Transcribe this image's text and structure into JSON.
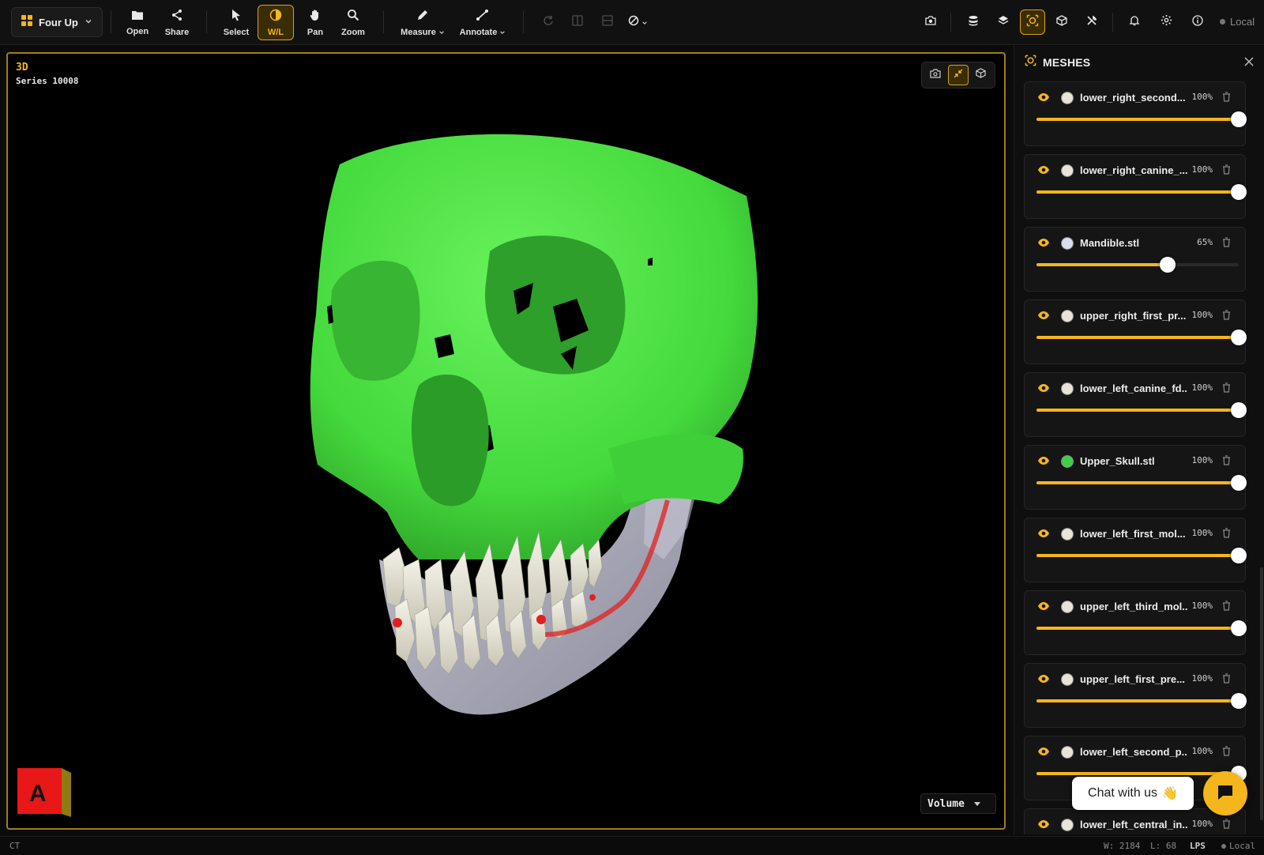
{
  "toolbar": {
    "layout_label": "Four Up",
    "tools": {
      "open": "Open",
      "share": "Share",
      "select": "Select",
      "wl": "W/L",
      "pan": "Pan",
      "zoom": "Zoom",
      "measure": "Measure",
      "annotate": "Annotate"
    },
    "active_tool": "W/L",
    "storage_label": "Local",
    "right_icons": [
      "camera-icon",
      "database-icon",
      "layers-icon",
      "meshes-icon",
      "cube-icon",
      "tools-icon",
      "bell-icon",
      "gear-icon",
      "info-icon"
    ]
  },
  "viewport": {
    "title": "3D",
    "series": "Series 10008",
    "render_mode": "Volume",
    "orientation_label": "A",
    "tools": [
      "camera-icon",
      "collapse-icon",
      "cube-icon"
    ]
  },
  "panel": {
    "title": "MESHES",
    "meshes": [
      {
        "name": "lower_right_second...",
        "opacity": "100%",
        "value": 1.0,
        "color": "#e8e4d8"
      },
      {
        "name": "lower_right_canine_...",
        "opacity": "100%",
        "value": 1.0,
        "color": "#e8e4d8"
      },
      {
        "name": "Mandible.stl",
        "opacity": "65%",
        "value": 0.65,
        "color": "#dcdcf0"
      },
      {
        "name": "upper_right_first_pr...",
        "opacity": "100%",
        "value": 1.0,
        "color": "#e8e4d8"
      },
      {
        "name": "lower_left_canine_fd...",
        "opacity": "100%",
        "value": 1.0,
        "color": "#e8e4d8"
      },
      {
        "name": "Upper_Skull.stl",
        "opacity": "100%",
        "value": 1.0,
        "color": "#3ecf4a"
      },
      {
        "name": "lower_left_first_mol...",
        "opacity": "100%",
        "value": 1.0,
        "color": "#e8e4d8"
      },
      {
        "name": "upper_left_third_mol...",
        "opacity": "100%",
        "value": 1.0,
        "color": "#e8e4d8"
      },
      {
        "name": "upper_left_first_pre...",
        "opacity": "100%",
        "value": 1.0,
        "color": "#e8e4d8"
      },
      {
        "name": "lower_left_second_p...",
        "opacity": "100%",
        "value": 1.0,
        "color": "#e8e4d8"
      },
      {
        "name": "lower_left_central_in...",
        "opacity": "100%",
        "value": 1.0,
        "color": "#e8e4d8"
      }
    ]
  },
  "chat": {
    "label": "Chat with us",
    "emoji": "👋"
  },
  "status": {
    "modality": "CT",
    "window": "W: 2184",
    "level": "L: 68",
    "orientation": "LPS",
    "storage": "Local"
  },
  "colors": {
    "accent": "#f5b51c",
    "skull": "#4fe84a",
    "mandible": "#c7c7d6",
    "nerve": "#e02020"
  }
}
